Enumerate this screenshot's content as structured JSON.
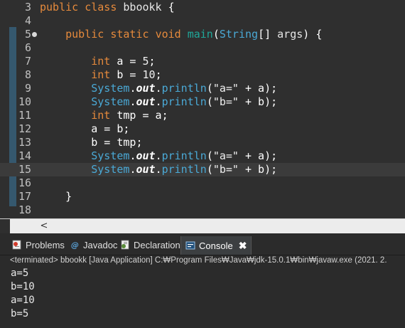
{
  "editor": {
    "lines": [
      {
        "n": "3",
        "parts": [
          [
            "kw",
            "public"
          ],
          [
            "p",
            " "
          ],
          [
            "kw",
            "class"
          ],
          [
            "p",
            " "
          ],
          [
            "cls",
            "bbookk"
          ],
          [
            "p",
            " {"
          ]
        ]
      },
      {
        "n": "4",
        "parts": []
      },
      {
        "n": "5",
        "parts": [
          [
            "p",
            "    "
          ],
          [
            "kw",
            "public"
          ],
          [
            "p",
            " "
          ],
          [
            "kw",
            "static"
          ],
          [
            "p",
            " "
          ],
          [
            "kw",
            "void"
          ],
          [
            "p",
            " "
          ],
          [
            "meth",
            "main"
          ],
          [
            "p",
            "("
          ],
          [
            "type",
            "String"
          ],
          [
            "p",
            "[] "
          ],
          [
            "cls",
            "args"
          ],
          [
            "p",
            ") {"
          ]
        ]
      },
      {
        "n": "6",
        "parts": []
      },
      {
        "n": "7",
        "parts": [
          [
            "p",
            "        "
          ],
          [
            "kw",
            "int"
          ],
          [
            "p",
            " a = "
          ],
          [
            "num",
            "5"
          ],
          [
            "p",
            ";"
          ]
        ]
      },
      {
        "n": "8",
        "parts": [
          [
            "p",
            "        "
          ],
          [
            "kw",
            "int"
          ],
          [
            "p",
            " b = "
          ],
          [
            "num",
            "10"
          ],
          [
            "p",
            ";"
          ]
        ]
      },
      {
        "n": "9",
        "parts": [
          [
            "p",
            "        "
          ],
          [
            "type",
            "System"
          ],
          [
            "p",
            "."
          ],
          [
            "out",
            "out"
          ],
          [
            "p",
            "."
          ],
          [
            "type",
            "println"
          ],
          [
            "p",
            "("
          ],
          [
            "str",
            "\"a=\""
          ],
          [
            "p",
            " + a);"
          ]
        ]
      },
      {
        "n": "10",
        "parts": [
          [
            "p",
            "        "
          ],
          [
            "type",
            "System"
          ],
          [
            "p",
            "."
          ],
          [
            "out",
            "out"
          ],
          [
            "p",
            "."
          ],
          [
            "type",
            "println"
          ],
          [
            "p",
            "("
          ],
          [
            "str",
            "\"b=\""
          ],
          [
            "p",
            " + b);"
          ]
        ]
      },
      {
        "n": "11",
        "parts": [
          [
            "p",
            "        "
          ],
          [
            "kw",
            "int"
          ],
          [
            "p",
            " tmp = a;"
          ]
        ]
      },
      {
        "n": "12",
        "parts": [
          [
            "p",
            "        a = b;"
          ]
        ]
      },
      {
        "n": "13",
        "parts": [
          [
            "p",
            "        b = tmp;"
          ]
        ]
      },
      {
        "n": "14",
        "parts": [
          [
            "p",
            "        "
          ],
          [
            "type",
            "System"
          ],
          [
            "p",
            "."
          ],
          [
            "out",
            "out"
          ],
          [
            "p",
            "."
          ],
          [
            "type",
            "println"
          ],
          [
            "p",
            "("
          ],
          [
            "str",
            "\"a=\""
          ],
          [
            "p",
            " + a);"
          ]
        ]
      },
      {
        "n": "15",
        "parts": [
          [
            "p",
            "        "
          ],
          [
            "type",
            "System"
          ],
          [
            "p",
            "."
          ],
          [
            "out",
            "out"
          ],
          [
            "p",
            "."
          ],
          [
            "type",
            "println"
          ],
          [
            "p",
            "("
          ],
          [
            "str",
            "\"b=\""
          ],
          [
            "p",
            " + b);"
          ]
        ]
      },
      {
        "n": "16",
        "parts": []
      },
      {
        "n": "17",
        "parts": [
          [
            "p",
            "    }"
          ]
        ]
      },
      {
        "n": "18",
        "parts": []
      }
    ],
    "current_line": "15",
    "scroll_arrow": "<"
  },
  "tabs": {
    "problems": "Problems",
    "javadoc": "Javadoc",
    "declaration": "Declaration",
    "console": "Console",
    "close": "✖"
  },
  "console": {
    "status": "<terminated> bbookk [Java Application] C:₩Program Files₩Java₩jdk-15.0.1₩bin₩javaw.exe  (2021. 2.",
    "output": [
      "a=5",
      "b=10",
      "a=10",
      "b=5"
    ]
  }
}
